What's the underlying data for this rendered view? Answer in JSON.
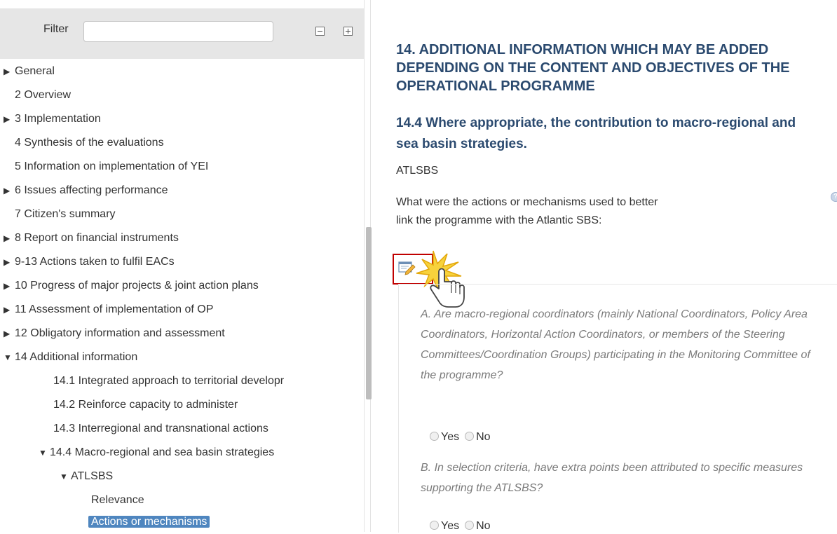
{
  "filter": {
    "label": "Filter",
    "value": "",
    "placeholder": ""
  },
  "tree": {
    "items": [
      {
        "label": "General",
        "marker": "▶"
      },
      {
        "label": "2 Overview",
        "marker": ""
      },
      {
        "label": "3 Implementation",
        "marker": "▶"
      },
      {
        "label": "4 Synthesis of the evaluations",
        "marker": ""
      },
      {
        "label": "5 Information on implementation of YEI",
        "marker": ""
      },
      {
        "label": "6 Issues affecting performance",
        "marker": "▶"
      },
      {
        "label": "7 Citizen's summary",
        "marker": ""
      },
      {
        "label": "8 Report on financial instruments",
        "marker": "▶"
      },
      {
        "label": "9-13 Actions taken to fulfil EACs",
        "marker": "▶"
      },
      {
        "label": "10 Progress of major projects & joint action plans",
        "marker": "▶"
      },
      {
        "label": "11 Assessment of implementation of OP",
        "marker": "▶"
      },
      {
        "label": "12 Obligatory information and assessment",
        "marker": "▶"
      },
      {
        "label": "14 Additional information",
        "marker": "▼"
      },
      {
        "label": "14.1 Integrated approach to territorial developr",
        "marker": ""
      },
      {
        "label": "14.2 Reinforce capacity to administer",
        "marker": ""
      },
      {
        "label": "14.3 Interregional and transnational actions",
        "marker": ""
      },
      {
        "label": "14.4 Macro-regional and sea basin strategies",
        "marker": "▼"
      },
      {
        "label": "ATLSBS",
        "marker": "▼"
      },
      {
        "label": "Relevance",
        "marker": ""
      },
      {
        "label": "Actions or mechanisms",
        "marker": "",
        "selected": true
      }
    ]
  },
  "content": {
    "section_title": "14. ADDITIONAL INFORMATION WHICH MAY BE ADDED DEPENDING ON THE CONTENT AND OBJECTIVES OF THE OPERATIONAL PROGRAMME",
    "subsection_title": "14.4 Where appropriate, the contribution to macro-regional and sea basin strategies.",
    "strategy_code": "ATLSBS",
    "question": "What were the actions or mechanisms used to better link the programme with the Atlantic SBS:",
    "help_icon": "?",
    "answers": [
      {
        "text": "A. Are macro-regional coordinators (mainly National Coordinators, Policy Area Coordinators, Horizontal Action Coordinators, or members of the Steering Committees/Coordination Groups) participating in the Monitoring Committee of the programme?",
        "yes_label": "Yes",
        "no_label": "No"
      },
      {
        "text": "B. In selection criteria, have extra points been attributed to specific measures supporting the ATLSBS?",
        "yes_label": "Yes",
        "no_label": "No"
      }
    ]
  },
  "colors": {
    "heading": "#2b4a6f",
    "selected_bg": "#4f86bf",
    "edit_highlight": "#c00000",
    "muted_text": "#7a7a7a"
  },
  "icons": {
    "edit_button": "edit-form-icon",
    "cursor": "hand-pointer-icon",
    "burst": "click-burst-icon"
  }
}
